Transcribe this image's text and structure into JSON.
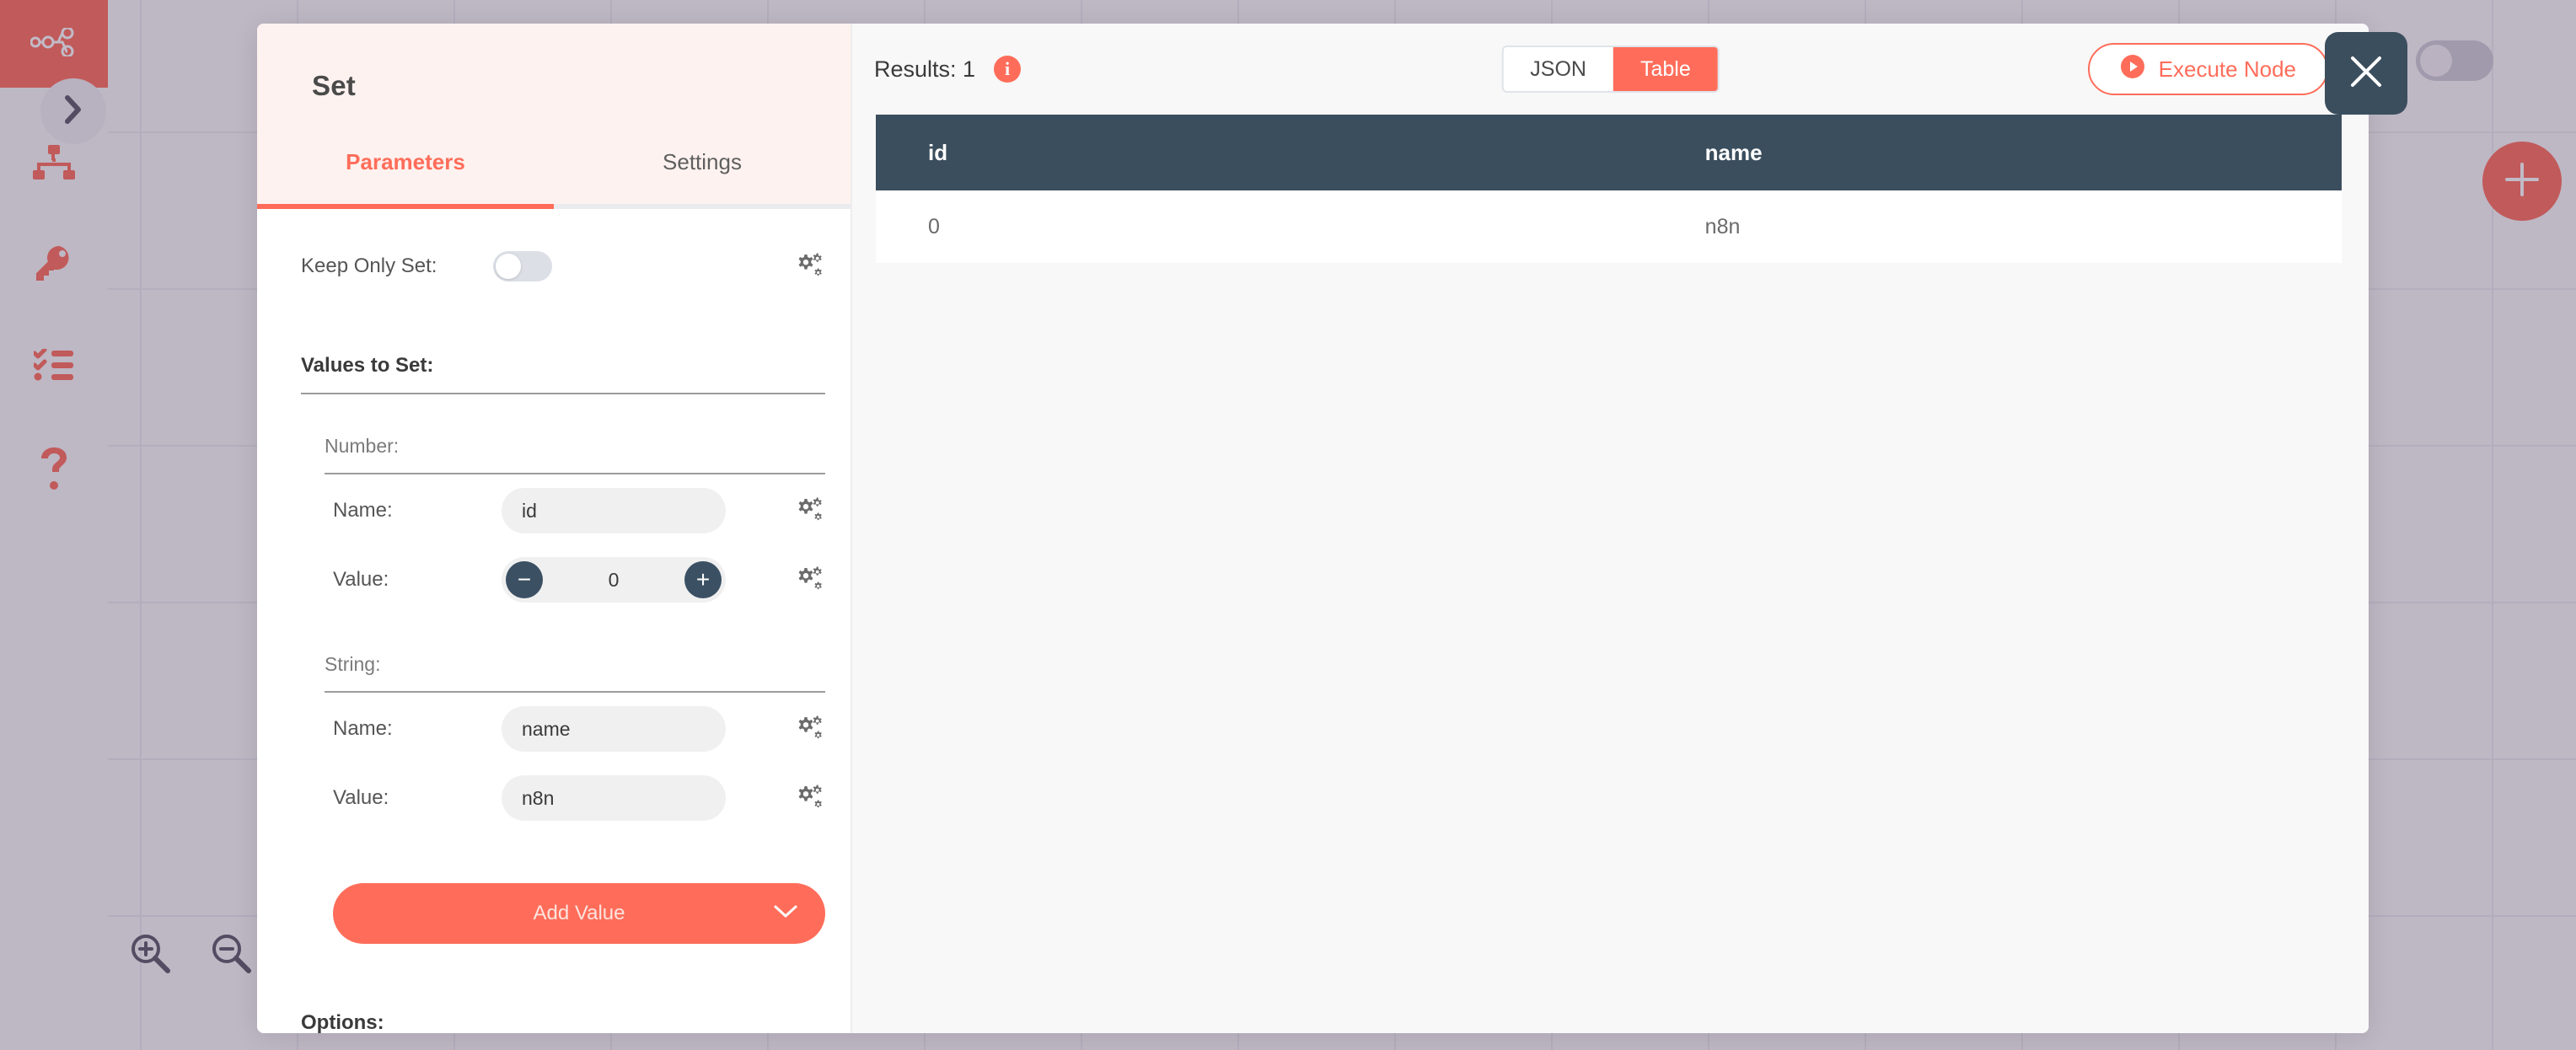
{
  "sidebar": {
    "logo_icon": "n8n-logo-icon",
    "items": [
      {
        "name": "expand-sidebar",
        "icon": "chevron-right-icon"
      },
      {
        "name": "workflows",
        "icon": "sitemap-icon"
      },
      {
        "name": "credentials",
        "icon": "key-icon"
      },
      {
        "name": "executions",
        "icon": "task-list-icon"
      },
      {
        "name": "help",
        "icon": "question-mark-icon"
      }
    ]
  },
  "canvas": {
    "add_node_icon": "plus-icon",
    "zoom_in_icon": "zoom-in-icon",
    "zoom_out_icon": "zoom-out-icon"
  },
  "modal": {
    "close_icon": "close-icon",
    "node_title": "Set",
    "tabs": [
      {
        "label": "Parameters",
        "active": true
      },
      {
        "label": "Settings",
        "active": false
      }
    ],
    "parameters": {
      "keep_only_set": {
        "label": "Keep Only Set:",
        "value": false,
        "gear_icon": "gear-options-icon"
      },
      "values_to_set_title": "Values to Set:",
      "groups": [
        {
          "type_label": "Number:",
          "fields": [
            {
              "label": "Name:",
              "value": "id",
              "control": "text",
              "gear_icon": "gear-options-icon"
            },
            {
              "label": "Value:",
              "value": "0",
              "control": "stepper",
              "decrement_icon": "minus-icon",
              "increment_icon": "plus-icon",
              "gear_icon": "gear-options-icon"
            }
          ]
        },
        {
          "type_label": "String:",
          "fields": [
            {
              "label": "Name:",
              "value": "name",
              "control": "text",
              "gear_icon": "gear-options-icon"
            },
            {
              "label": "Value:",
              "value": "n8n",
              "control": "text",
              "gear_icon": "gear-options-icon"
            }
          ]
        }
      ],
      "add_value_button": {
        "label": "Add Value",
        "chevron_icon": "chevron-down-icon"
      },
      "options_title": "Options:"
    },
    "results": {
      "count_label": "Results: 1",
      "info_icon": "info-icon",
      "view_toggle": [
        {
          "label": "JSON",
          "selected": false
        },
        {
          "label": "Table",
          "selected": true
        }
      ],
      "execute_button": {
        "label": "Execute Node",
        "icon": "play-icon"
      },
      "table": {
        "columns": [
          "id",
          "name"
        ],
        "rows": [
          [
            "0",
            "n8n"
          ]
        ]
      }
    }
  },
  "colors": {
    "accent": "#ff6d5a",
    "header_bg": "#fdf2ef",
    "table_header": "#3b4e5e",
    "canvas_bg": "#faf9fb",
    "overlay": "rgba(74,56,90,0.34)"
  }
}
